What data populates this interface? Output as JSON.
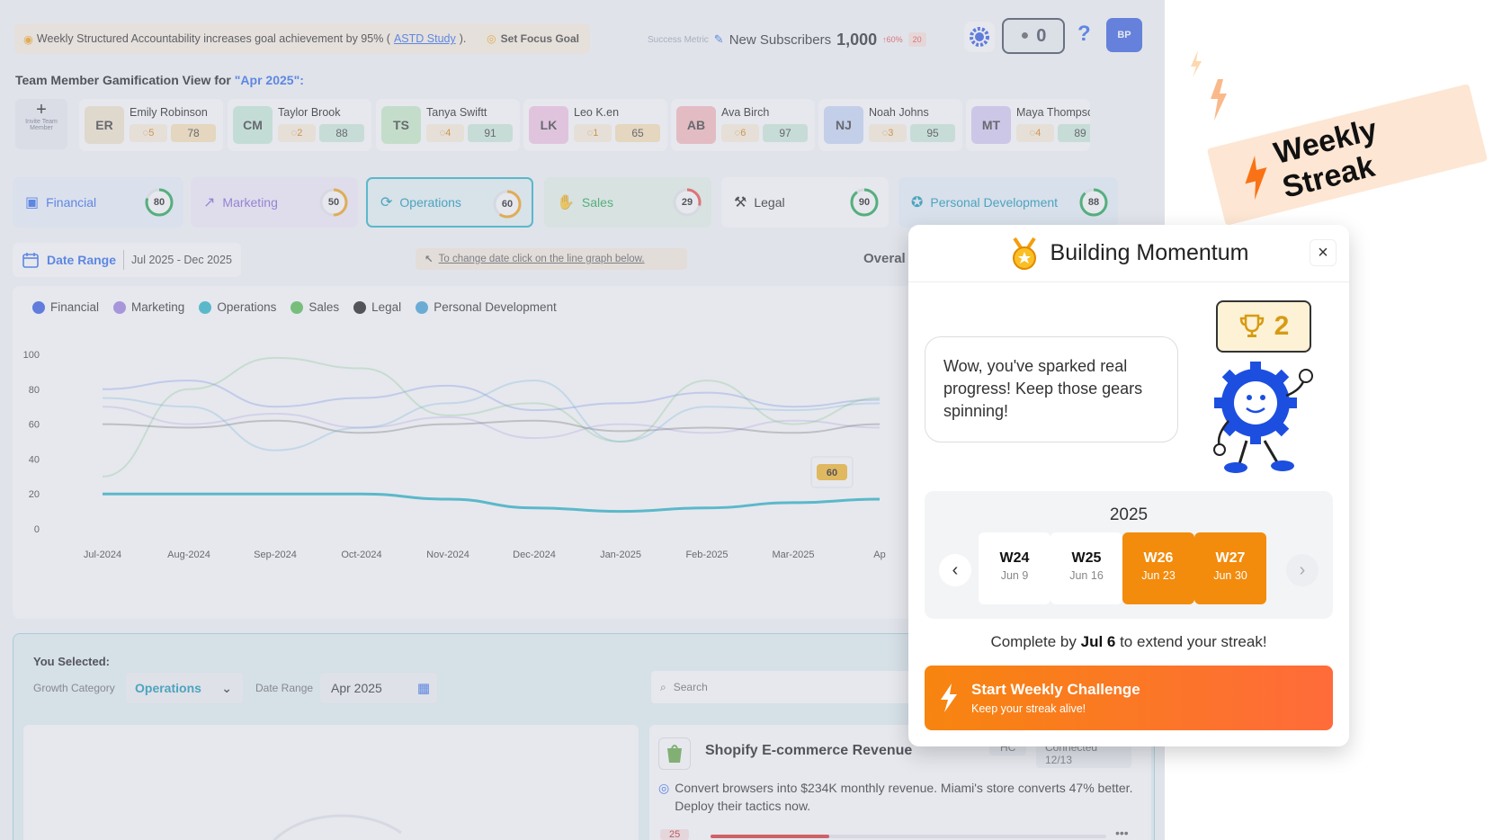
{
  "topbar": {
    "tip_text": "Weekly Structured Accountability increases goal achievement by 95% (",
    "tip_link": "ASTD Study",
    "tip_end": ").",
    "focus_label": "Set Focus Goal",
    "metric_label": "Success Metric",
    "metric_name": "New Subscribers",
    "metric_value": "1,000",
    "metric_pct": "↑60%",
    "metric_badge": "20",
    "notif_count": "0",
    "help": "?",
    "avatar": "BP"
  },
  "team": {
    "title": "Team Member Gamification View for ",
    "period": "\"Apr 2025\":",
    "invite_label": "Invite Team Member",
    "members": [
      {
        "initials": "ER",
        "name": "Emily Robinson",
        "streak": "5",
        "score": "78",
        "avatar_color": "#f4e6c9",
        "score_color": "#fce2b3"
      },
      {
        "initials": "CM",
        "name": "Taylor Brook",
        "streak": "2",
        "score": "88",
        "avatar_color": "#c8ecd9",
        "score_color": "#cdecd9"
      },
      {
        "initials": "TS",
        "name": "Tanya Swiftt",
        "streak": "4",
        "score": "91",
        "avatar_color": "#c9edc5",
        "score_color": "#cdecd9"
      },
      {
        "initials": "LK",
        "name": "Leo K.en",
        "streak": "1",
        "score": "65",
        "avatar_color": "#f6c6e6",
        "score_color": "#fce2b3"
      },
      {
        "initials": "AB",
        "name": "Ava Birch",
        "streak": "6",
        "score": "97",
        "avatar_color": "#f8b8b8",
        "score_color": "#cdecd9"
      },
      {
        "initials": "NJ",
        "name": "Noah Johns",
        "streak": "3",
        "score": "95",
        "avatar_color": "#c7d6f6",
        "score_color": "#cdecd9"
      },
      {
        "initials": "MT",
        "name": "Maya Thompso",
        "streak": "4",
        "score": "89",
        "avatar_color": "#d6c8f4",
        "score_color": "#cdecd9"
      }
    ]
  },
  "categories": [
    {
      "label": "Financial",
      "score": "80",
      "color": "#2563eb",
      "bg": "#eef2fd",
      "ring": "#16a34a",
      "pct": 0.8
    },
    {
      "label": "Marketing",
      "score": "50",
      "color": "#7c5cd6",
      "bg": "#f4eefb",
      "ring": "#f59e0b",
      "pct": 0.5
    },
    {
      "label": "Operations",
      "score": "60",
      "color": "#0891b2",
      "bg": "#e7f5f7",
      "ring": "#f59e0b",
      "pct": 0.6
    },
    {
      "label": "Sales",
      "score": "29",
      "color": "#16a34a",
      "bg": "#e8f6ea",
      "ring": "#ef4444",
      "pct": 0.29
    },
    {
      "label": "Legal",
      "score": "90",
      "color": "#111111",
      "bg": "#ffffff",
      "ring": "#16a34a",
      "pct": 0.9
    },
    {
      "label": "Personal Development",
      "score": "88",
      "color": "#0891b2",
      "bg": "#e9f3fa",
      "ring": "#16a34a",
      "pct": 0.88
    }
  ],
  "filters": {
    "date_range_label": "Date Range",
    "date_range_value": "Jul 2025 - Dec 2025",
    "hint": "To change date click on the line graph below.",
    "overall": "Overal"
  },
  "chart_data": {
    "type": "line",
    "x": [
      "Jul-2024",
      "Aug-2024",
      "Sep-2024",
      "Oct-2024",
      "Nov-2024",
      "Dec-2024",
      "Jan-2025",
      "Feb-2025",
      "Mar-2025",
      "Ap"
    ],
    "yticks": [
      "100",
      "80",
      "60",
      "40",
      "20",
      "0"
    ],
    "ylim": [
      0,
      100
    ],
    "series": [
      {
        "name": "Financial",
        "color": "#2952e3",
        "values": [
          80,
          85,
          70,
          75,
          82,
          68,
          72,
          78,
          70,
          74
        ]
      },
      {
        "name": "Marketing",
        "color": "#9b7be0",
        "values": [
          70,
          60,
          66,
          58,
          64,
          52,
          60,
          55,
          62,
          58
        ]
      },
      {
        "name": "Operations",
        "color": "#20b2c5",
        "values": [
          20,
          20,
          20,
          20,
          17,
          12,
          10,
          12,
          15,
          17
        ]
      },
      {
        "name": "Sales",
        "color": "#4cbb4a",
        "values": [
          30,
          80,
          98,
          92,
          65,
          72,
          50,
          85,
          60,
          75
        ]
      },
      {
        "name": "Legal",
        "color": "#111111",
        "values": [
          60,
          58,
          62,
          55,
          60,
          62,
          56,
          58,
          55,
          60
        ]
      },
      {
        "name": "Personal Development",
        "color": "#3a9fd6",
        "values": [
          75,
          70,
          45,
          58,
          72,
          85,
          50,
          70,
          68,
          72
        ]
      }
    ],
    "tooltip": "60"
  },
  "selection": {
    "title": "You Selected:",
    "growth_label": "Growth Category",
    "growth_value": "Operations",
    "date_label": "Date Range",
    "date_value": "Apr 2025",
    "search_placeholder": "Search"
  },
  "integration": {
    "title": "Shopify E-commerce Revenue",
    "hc": "HC",
    "connected": "Connected 12/13",
    "desc": "Convert browsers into $234K monthly revenue. Miami's store converts 47% better. Deploy their tactics now.",
    "progress_label": "25"
  },
  "modal": {
    "title": "Building Momentum",
    "close": "×",
    "message": "Wow, you've sparked real progress! Keep those gears spinning!",
    "trophies": "2",
    "year": "2025",
    "weeks": [
      {
        "w": "W24",
        "d": "Jun 9",
        "on": false
      },
      {
        "w": "W25",
        "d": "Jun 16",
        "on": false
      },
      {
        "w": "W26",
        "d": "Jun 23",
        "on": true
      },
      {
        "w": "W27",
        "d": "Jun 30",
        "on": true
      }
    ],
    "complete_pre": "Complete by ",
    "complete_date": "Jul 6",
    "complete_post": " to extend your streak!",
    "cta_title": "Start Weekly Challenge",
    "cta_sub": "Keep your streak alive!"
  },
  "banner": {
    "text": "Weekly Streak"
  }
}
